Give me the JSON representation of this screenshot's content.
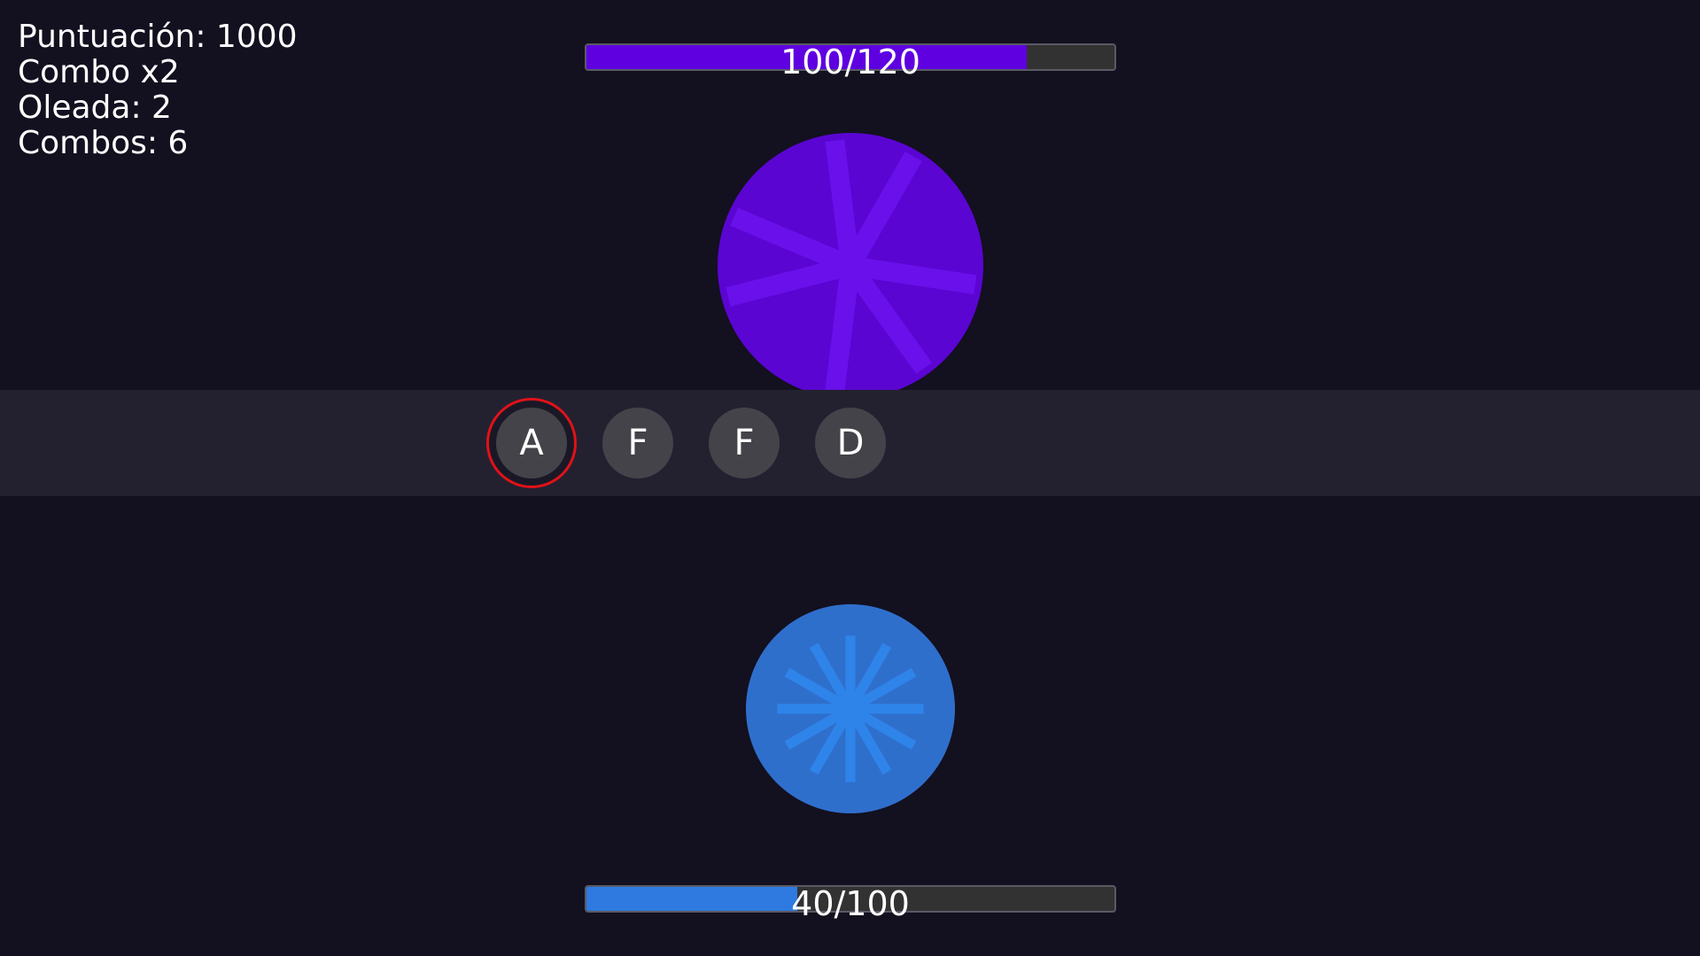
{
  "hud": {
    "score": "Puntuación: 1000",
    "combo": "Combo x2",
    "wave": "Oleada: 2",
    "combos": "Combos: 6"
  },
  "enemy": {
    "hp_text": "100/120",
    "hp_current": 100,
    "hp_max": 120,
    "color": "#5f00e0",
    "orb_color": "#5a05d2",
    "ray_color": "#6a10ea"
  },
  "player": {
    "hp_text": "40/100",
    "hp_current": 40,
    "hp_max": 100,
    "color": "#2f7ae0",
    "orb_color": "#2f6fcc",
    "ray_color": "#2f84ea"
  },
  "sequence": {
    "keys": [
      "A",
      "F",
      "F",
      "D"
    ],
    "active_index": 0,
    "highlight_color": "#e11218"
  }
}
